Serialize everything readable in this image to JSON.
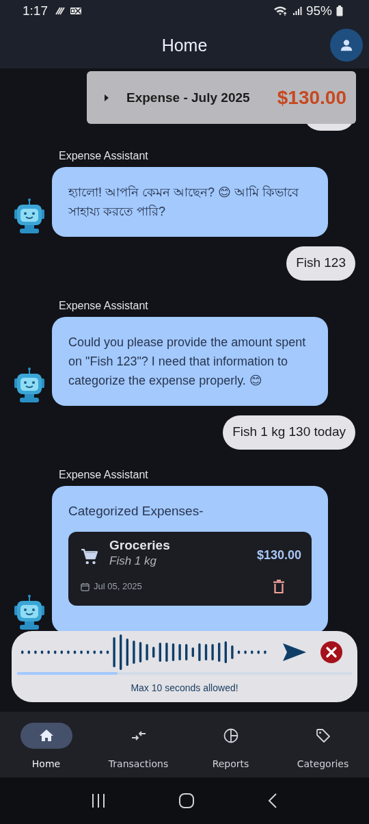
{
  "status_bar": {
    "time": "1:17",
    "battery": "95%"
  },
  "app_bar": {
    "title": "Home"
  },
  "summary_banner": {
    "label": "Expense - July 2025",
    "amount": "$130.00"
  },
  "messages": [
    {
      "kind": "user"
    },
    {
      "kind": "assistant",
      "sender": "Expense Assistant",
      "text": "হ্যালো! আপনি কেমন আছেন? 😊 আমি কিভাবে সাহায্য করতে পারি?"
    },
    {
      "kind": "user",
      "text": "Fish 123"
    },
    {
      "kind": "assistant",
      "sender": "Expense Assistant",
      "text": "Could you please provide the amount spent on \"Fish 123\"? I need that information to categorize the expense properly. 😊"
    },
    {
      "kind": "user",
      "text": "Fish 1 kg 130 today"
    },
    {
      "kind": "expenses",
      "sender": "Expense Assistant",
      "title": "Categorized Expenses-",
      "items": [
        {
          "category": "Groceries",
          "note": "Fish 1 kg",
          "amount": "$130.00",
          "date": "Jul 05, 2025"
        }
      ]
    }
  ],
  "recording": {
    "level": 0.3,
    "hint": "Max 10 seconds allowed!"
  },
  "nav": [
    {
      "label": "Home",
      "selected": true
    },
    {
      "label": "Transactions",
      "selected": false
    },
    {
      "label": "Reports",
      "selected": false
    },
    {
      "label": "Categories",
      "selected": false
    }
  ]
}
